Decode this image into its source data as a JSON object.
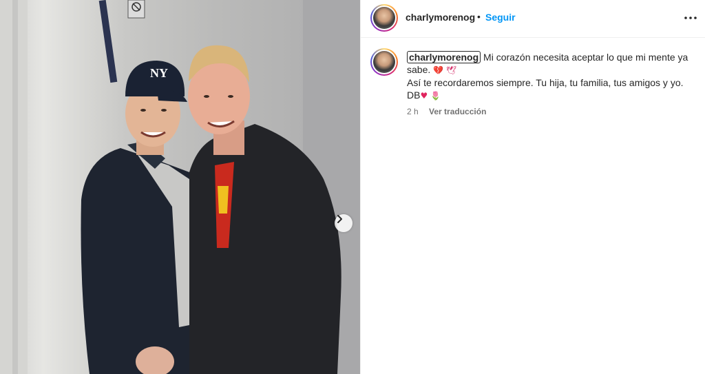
{
  "post": {
    "username": "charlymorenog",
    "separator": "•",
    "follow_label": "Seguir",
    "more_icon": "more-horizontal-icon"
  },
  "caption": {
    "username": "charlymorenog",
    "line1": "Mi corazón necesita aceptar lo que mi mente ya",
    "line2": "sabe.",
    "line2_emoji": "💔 🕊",
    "line3": "Así te recordaremos siempre. Tu hija, tu familia, tus amigos y yo.",
    "line4": "DB",
    "line4_emoji_heart": "♥",
    "line4_emoji_tulip": "🌷"
  },
  "meta": {
    "time": "2 h",
    "translate_label": "Ver traducción"
  },
  "photo": {
    "next_icon": "chevron-right-icon",
    "cap_logo": "NY"
  },
  "colors": {
    "accent": "#0095f6",
    "text": "#262626",
    "muted": "#737373"
  }
}
